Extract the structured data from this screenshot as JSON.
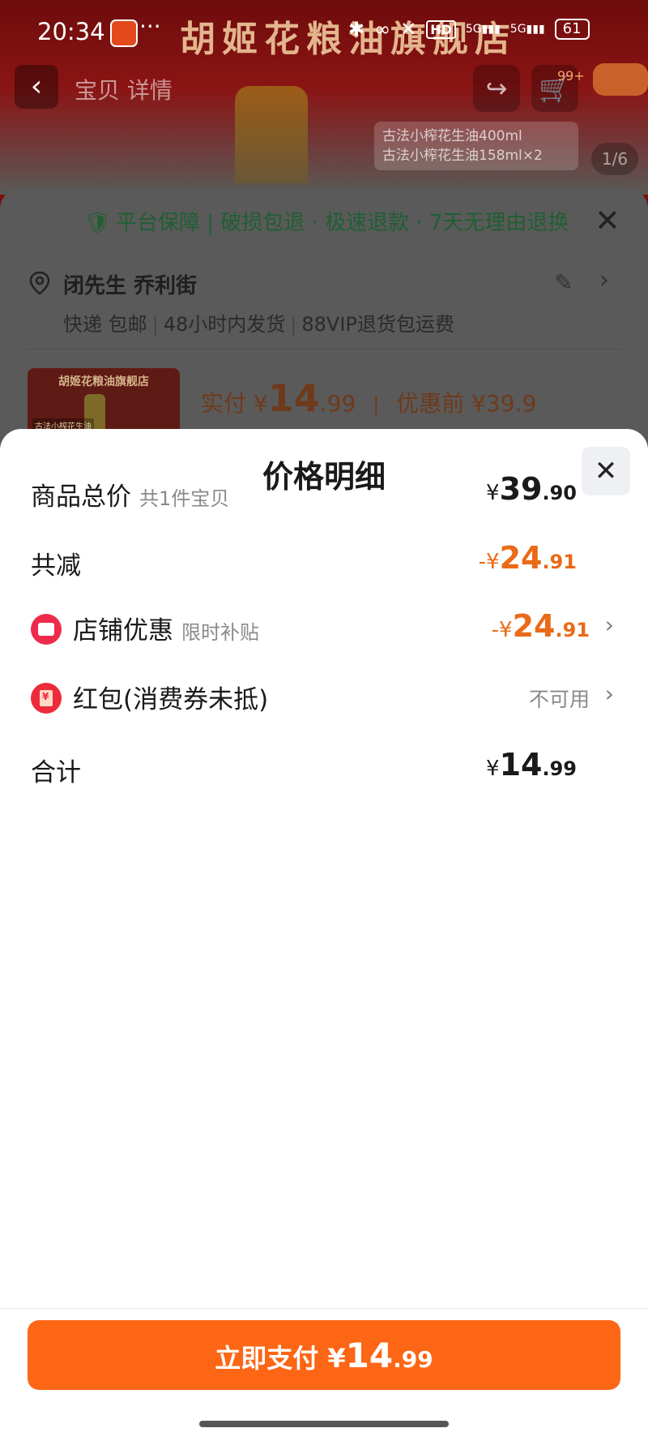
{
  "status_bar": {
    "time": "20:34",
    "more": "···",
    "hd": "HD",
    "net1": "5G",
    "net2": "5G",
    "battery": "61"
  },
  "product_page": {
    "shop_banner": "胡姬花粮油旗舰店",
    "nav_tabs": "宝贝  详情",
    "tag_line1": "古法小榨花生油400ml",
    "tag_line2": "古法小榨花生油158ml×2",
    "image_counter": "1/6",
    "cart_badge": "99+"
  },
  "checkout": {
    "guarantee": "平台保障 | 破损包退 · 极速退款 · 7天无理由退换",
    "address_name": "闭先生 乔利街",
    "shipping": {
      "method": "快递 包邮",
      "dispatch": "48小时内发货",
      "vip": "88VIP退货包运费"
    },
    "thumb_title": "胡姬花粮油旗舰店",
    "thumb_label": "古法小榨花生油",
    "paid_label": "实付",
    "paid_currency": "¥",
    "paid_int": "14",
    "paid_dec": ".99",
    "before_discount": "优惠前 ¥39.9"
  },
  "price_detail": {
    "title": "价格明细",
    "rows": [
      {
        "label": "商品总价",
        "sub": "共1件宝贝",
        "prefix": "¥",
        "int": "39",
        "dec": ".90"
      },
      {
        "label": "共减",
        "prefix": "-¥",
        "int": "24",
        "dec": ".91"
      },
      {
        "label": "店铺优惠",
        "sub": "限时补贴",
        "prefix": "-¥",
        "int": "24",
        "dec": ".91"
      },
      {
        "label": "红包(消费券未抵)",
        "value_text": "不可用"
      },
      {
        "label": "合计",
        "prefix": "¥",
        "int": "14",
        "dec": ".99"
      }
    ]
  },
  "pay_button": {
    "label": "立即支付",
    "prefix": "¥",
    "int": "14",
    "dec": ".99"
  },
  "colors": {
    "accent_orange": "#fc6615",
    "discount_orange": "#ea6a18",
    "icon_red": "#ee2b4c"
  }
}
